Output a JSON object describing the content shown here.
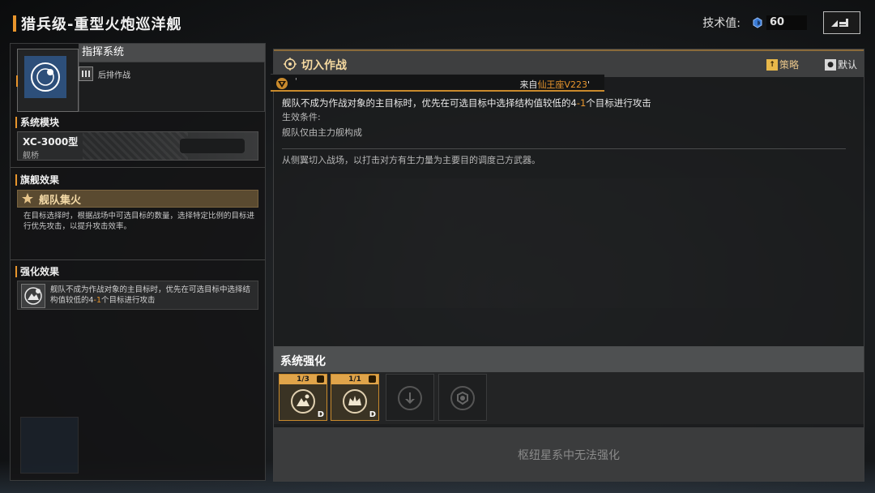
{
  "header": {
    "title": "猎兵级-重型火炮巡洋舰",
    "tech_label": "技术值:",
    "tech_value": "60"
  },
  "left_panel": {
    "command_title": "指挥系统",
    "command_subtitle": "后排作战",
    "module_section": "系统模块",
    "module_name": "XC-3000型",
    "module_type": "舰桥",
    "flagship_section": "旗舰效果",
    "flagship_name": "舰队集火",
    "flagship_desc": "在目标选择时，根据战场中可选目标的数量，选择特定比例的目标进行优先攻击，以提升攻击效率。",
    "enhance_section": "强化效果",
    "enhance_text_a": "舰队不成为作战对象的主目标时，优先在可选目标中选择结构值较低的4",
    "enhance_text_b": "-1",
    "enhance_text_c": "个目标进行攻击"
  },
  "right_panel": {
    "title": "切入作战",
    "strategy_button": "策略",
    "default_button": "默认",
    "source_quote": "'",
    "source_prefix": "来自",
    "source_name": "仙王座V223",
    "source_suffix": "'",
    "desc_a": "舰队不成为作战对象的主目标时，优先在可选目标中选择结构值较低的4",
    "desc_b": "-1",
    "desc_c": "个目标进行攻击",
    "condition_label": "生效条件:",
    "condition": "舰队仅由主力舰构成",
    "flavor": "从侧翼切入战场，以打击对方有生力量为主要目的调度己方武器。",
    "system_enhance_title": "系统强化",
    "slots": [
      {
        "count": "1/3",
        "grade": "D",
        "active": true
      },
      {
        "count": "1/1",
        "grade": "D",
        "active": true
      },
      {
        "active": false
      },
      {
        "active": false
      }
    ],
    "no_enhance_text": "枢纽星系中无法强化"
  },
  "colors": {
    "accent": "#e8952c",
    "panel_bg": "#1c1d1e",
    "highlight_gold": "#f5d9a0"
  }
}
